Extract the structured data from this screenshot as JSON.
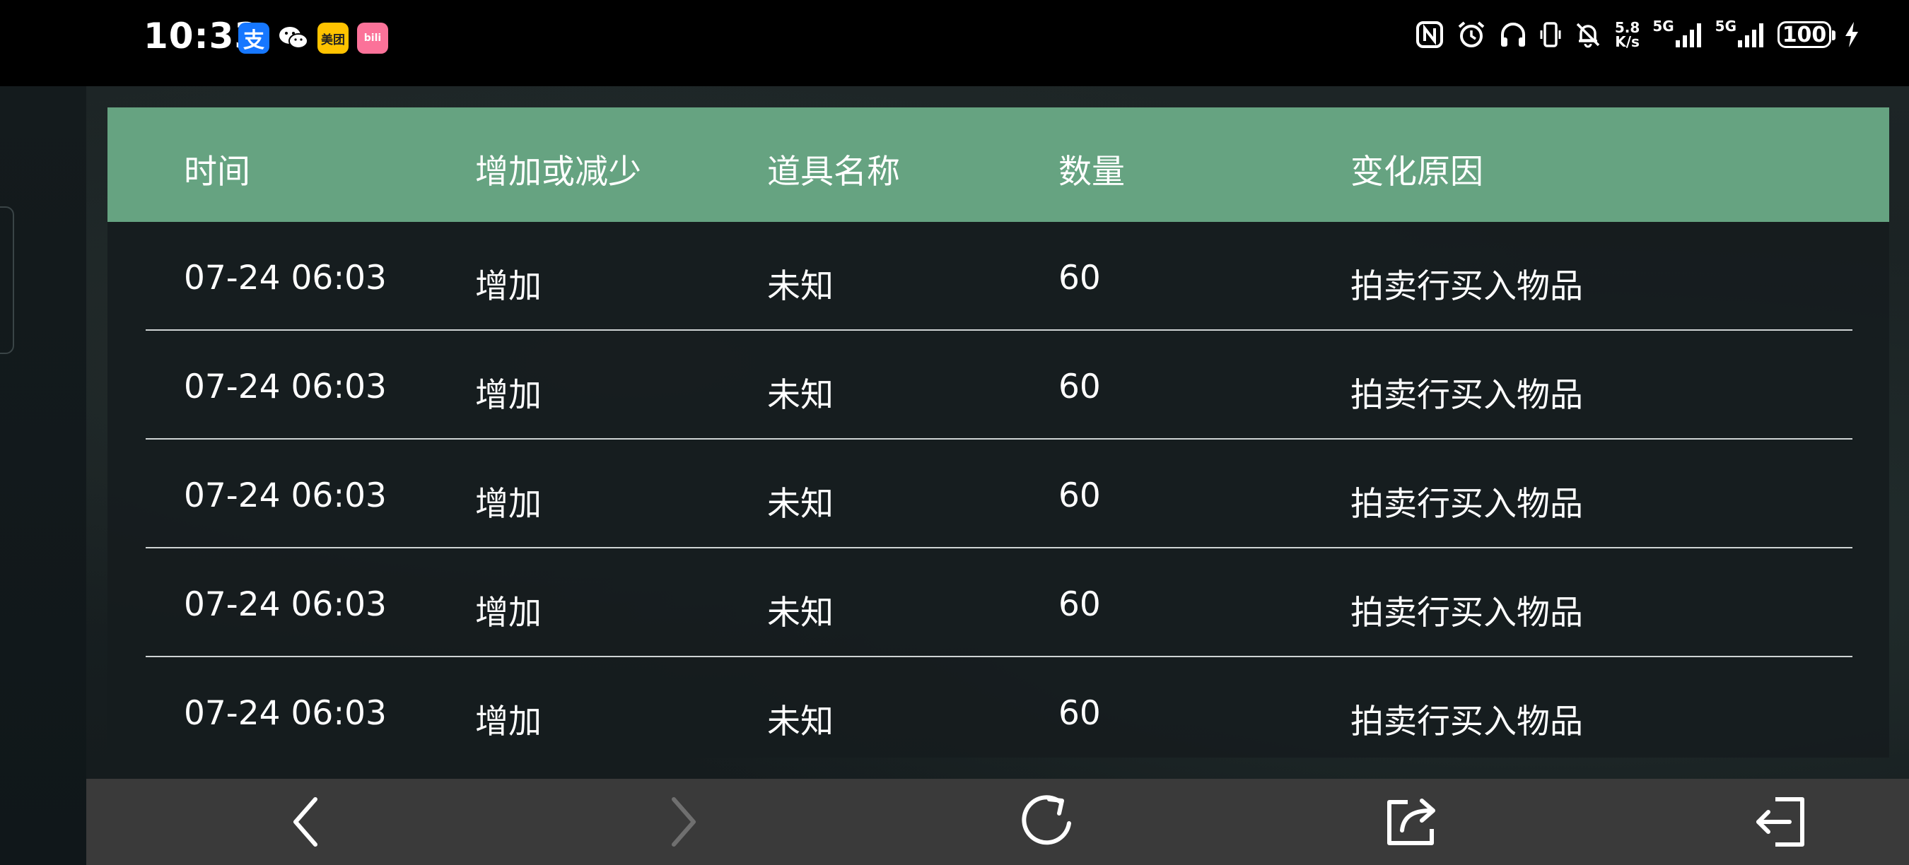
{
  "status_bar": {
    "time": "10:33",
    "apps": [
      {
        "name": "alipay-icon",
        "glyph": "支"
      },
      {
        "name": "wechat-icon",
        "glyph": ""
      },
      {
        "name": "meituan-icon",
        "glyph": "美团"
      },
      {
        "name": "bilibili-icon",
        "glyph": "bili"
      }
    ],
    "net_speed_value": "5.8",
    "net_speed_unit": "K/s",
    "signal_1_tag": "5G",
    "signal_2_tag": "5G",
    "battery": "100"
  },
  "table": {
    "header_color": "#66a381",
    "headers": [
      "时间",
      "增加或减少",
      "道具名称",
      "数量",
      "变化原因"
    ],
    "rows": [
      [
        "07-24 06:03",
        "增加",
        "未知",
        "60",
        "拍卖行买入物品"
      ],
      [
        "07-24 06:03",
        "增加",
        "未知",
        "60",
        "拍卖行买入物品"
      ],
      [
        "07-24 06:03",
        "增加",
        "未知",
        "60",
        "拍卖行买入物品"
      ],
      [
        "07-24 06:03",
        "增加",
        "未知",
        "60",
        "拍卖行买入物品"
      ],
      [
        "07-24 06:03",
        "增加",
        "未知",
        "60",
        "拍卖行买入物品"
      ]
    ]
  },
  "bottom_nav": {
    "items": [
      {
        "name": "back-arrow-icon",
        "enabled": true
      },
      {
        "name": "forward-arrow-icon",
        "enabled": false
      },
      {
        "name": "refresh-icon",
        "enabled": true
      },
      {
        "name": "share-icon",
        "enabled": true
      },
      {
        "name": "exit-icon",
        "enabled": true
      }
    ]
  }
}
